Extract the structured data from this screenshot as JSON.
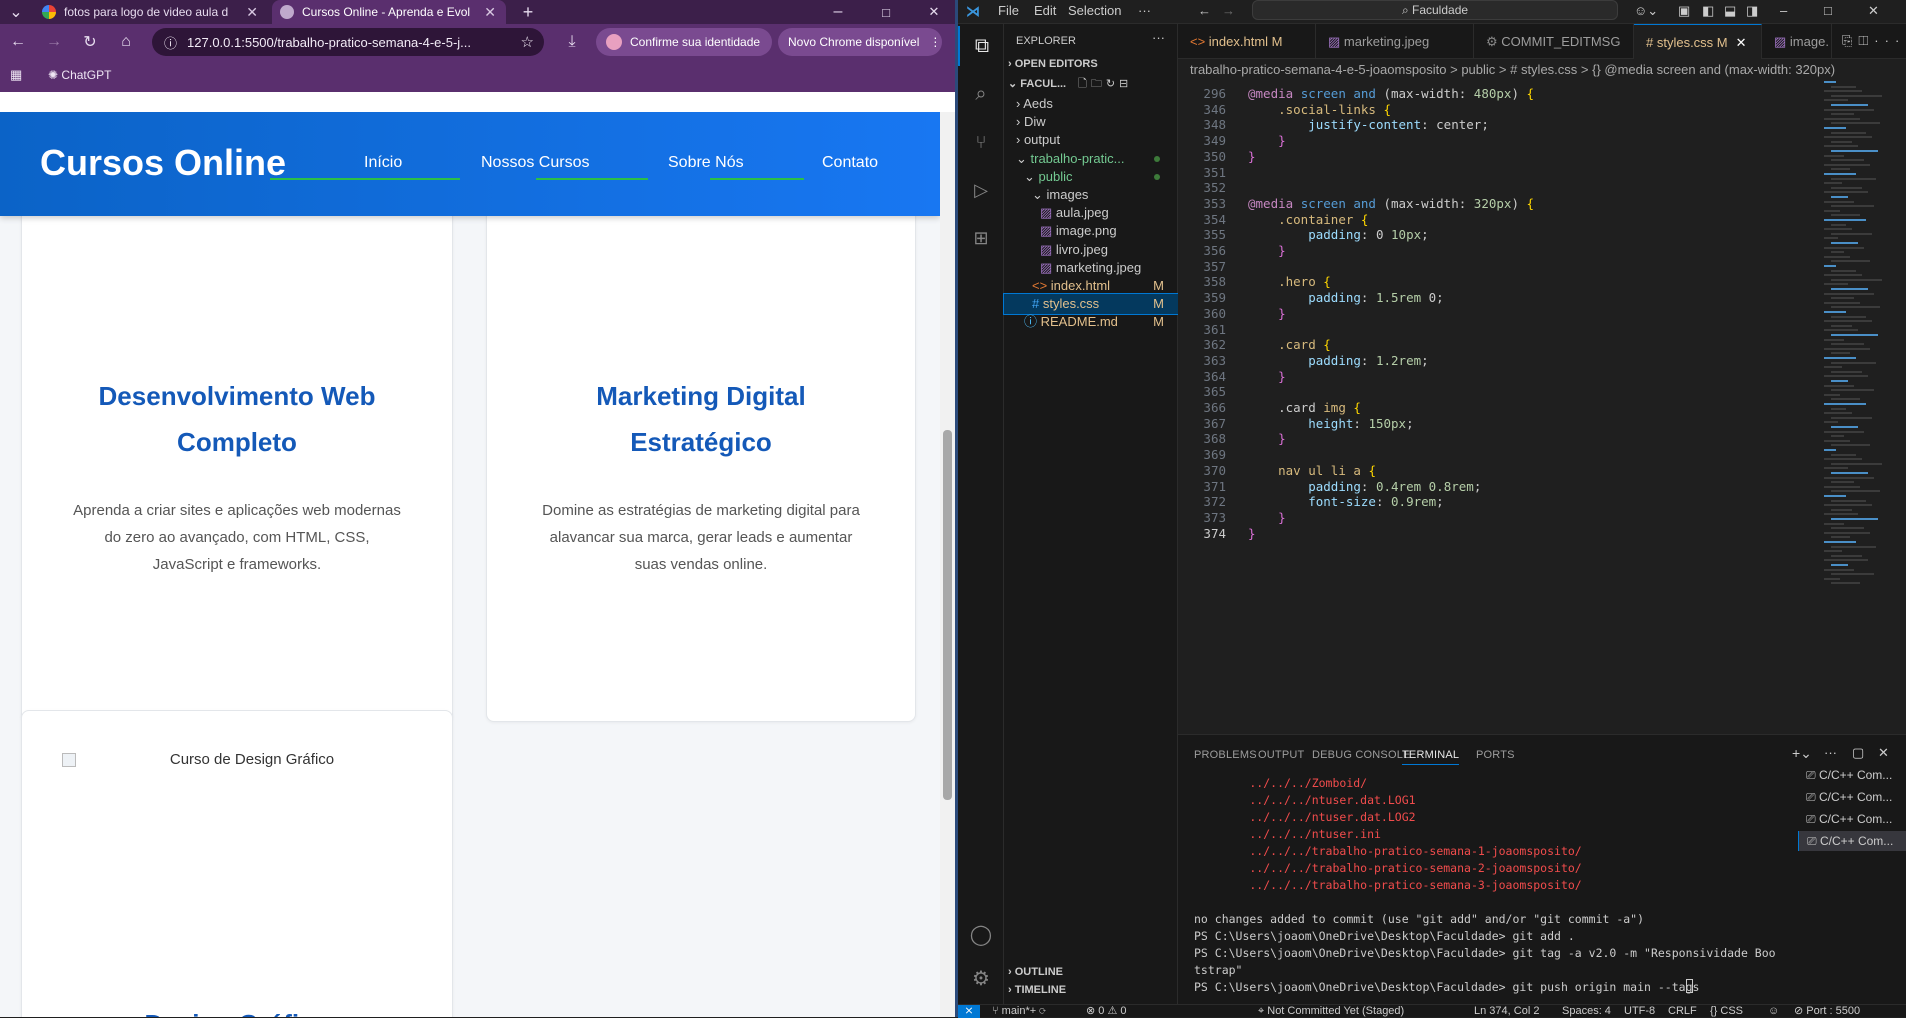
{
  "browser": {
    "tabs": [
      {
        "title": "fotos para logo de video aula d",
        "active": false
      },
      {
        "title": "Cursos Online - Aprenda e Evol",
        "active": true
      }
    ],
    "new_tab": "+",
    "window_controls": [
      "–",
      "□",
      "✕"
    ],
    "url": "127.0.0.1:5500/trabalho-pratico-semana-4-e-5-j...",
    "identity_pill": "Confirme sua identidade",
    "update_pill": "Novo Chrome disponível",
    "bookmark": "ChatGPT"
  },
  "site": {
    "logo": "Cursos Online",
    "nav": [
      "Início",
      "Nossos Cursos",
      "Sobre Nós",
      "Contato"
    ],
    "cards": [
      {
        "title_line1": "Desenvolvimento Web",
        "title_line2": "Completo",
        "desc": [
          "Aprenda a criar sites e aplicações web modernas",
          "do zero ao avançado, com HTML, CSS,",
          "JavaScript e frameworks."
        ]
      },
      {
        "title_line1": "Marketing Digital",
        "title_line2": "Estratégico",
        "desc": [
          "Domine as estratégias de marketing digital para",
          "alavancar sua marca, gerar leads e aumentar",
          "suas vendas online."
        ]
      },
      {
        "img_alt": "Curso de Design Gráfico",
        "title_partial": "Design Gráfico"
      }
    ]
  },
  "vscode": {
    "menu": [
      "File",
      "Edit",
      "Selection",
      "···"
    ],
    "search": "Faculdade",
    "explorer": {
      "header": "EXPLORER",
      "open_editors": "OPEN EDITORS",
      "root": "FACUL...",
      "tree": [
        {
          "label": "Aeds",
          "kind": "folder",
          "depth": 1
        },
        {
          "label": "Diw",
          "kind": "folder",
          "depth": 1
        },
        {
          "label": "output",
          "kind": "folder",
          "depth": 1
        },
        {
          "label": "trabalho-pratic...",
          "kind": "folder-open",
          "depth": 1
        },
        {
          "label": "public",
          "kind": "folder-open",
          "depth": 2
        },
        {
          "label": "images",
          "kind": "folder-open",
          "depth": 3
        },
        {
          "label": "aula.jpeg",
          "kind": "img",
          "depth": 4
        },
        {
          "label": "image.png",
          "kind": "img",
          "depth": 4
        },
        {
          "label": "livro.jpeg",
          "kind": "img",
          "depth": 4
        },
        {
          "label": "marketing.jpeg",
          "kind": "img",
          "depth": 4
        },
        {
          "label": "index.html",
          "kind": "html",
          "depth": 3,
          "badge": "M"
        },
        {
          "label": "styles.css",
          "kind": "css",
          "depth": 3,
          "badge": "M",
          "selected": true
        },
        {
          "label": "README.md",
          "kind": "info",
          "depth": 2,
          "badge": "M"
        }
      ],
      "outline": "OUTLINE",
      "timeline": "TIMELINE"
    },
    "editor_tabs": [
      {
        "label": "index.html M"
      },
      {
        "label": "marketing.jpeg"
      },
      {
        "label": "COMMIT_EDITMSG"
      },
      {
        "label": "# styles.css M",
        "active": true
      },
      {
        "label": "image."
      }
    ],
    "breadcrumb": "trabalho-pratico-semana-4-e-5-joaomsposito  >  public  >  # styles.css  >  {} @media screen and (max-width: 320px)",
    "code": [
      {
        "n": "296",
        "t": "@media screen and (max-width: 480px) {"
      },
      {
        "n": "346",
        "t": "    .social-links {"
      },
      {
        "n": "348",
        "t": "        justify-content: center;"
      },
      {
        "n": "349",
        "t": "    }"
      },
      {
        "n": "350",
        "t": "}"
      },
      {
        "n": "351",
        "t": ""
      },
      {
        "n": "352",
        "t": ""
      },
      {
        "n": "353",
        "t": "@media screen and (max-width: 320px) {"
      },
      {
        "n": "354",
        "t": "    .container {"
      },
      {
        "n": "355",
        "t": "        padding: 0 10px;"
      },
      {
        "n": "356",
        "t": "    }"
      },
      {
        "n": "357",
        "t": ""
      },
      {
        "n": "358",
        "t": "    .hero {"
      },
      {
        "n": "359",
        "t": "        padding: 1.5rem 0;"
      },
      {
        "n": "360",
        "t": "    }"
      },
      {
        "n": "361",
        "t": ""
      },
      {
        "n": "362",
        "t": "    .card {"
      },
      {
        "n": "363",
        "t": "        padding: 1.2rem;"
      },
      {
        "n": "364",
        "t": "    }"
      },
      {
        "n": "365",
        "t": ""
      },
      {
        "n": "366",
        "t": "    .card img {"
      },
      {
        "n": "367",
        "t": "        height: 150px;"
      },
      {
        "n": "368",
        "t": "    }"
      },
      {
        "n": "369",
        "t": ""
      },
      {
        "n": "370",
        "t": "    nav ul li a {"
      },
      {
        "n": "371",
        "t": "        padding: 0.4rem 0.8rem;"
      },
      {
        "n": "372",
        "t": "        font-size: 0.9rem;"
      },
      {
        "n": "373",
        "t": "    }"
      },
      {
        "n": "374",
        "t": "}"
      }
    ],
    "panel_tabs": [
      "PROBLEMS",
      "OUTPUT",
      "DEBUG CONSOLE",
      "TERMINAL",
      "PORTS"
    ],
    "terminal": [
      {
        "t": "        ../../../Zomboid/",
        "red": true
      },
      {
        "t": "        ../../../ntuser.dat.LOG1",
        "red": true
      },
      {
        "t": "        ../../../ntuser.dat.LOG2",
        "red": true
      },
      {
        "t": "        ../../../ntuser.ini",
        "red": true
      },
      {
        "t": "        ../../../trabalho-pratico-semana-1-joaomsposito/",
        "red": true
      },
      {
        "t": "        ../../../trabalho-pratico-semana-2-joaomsposito/",
        "red": true
      },
      {
        "t": "        ../../../trabalho-pratico-semana-3-joaomsposito/",
        "red": true
      },
      {
        "t": "",
        "red": false
      },
      {
        "t": "no changes added to commit (use \"git add\" and/or \"git commit -a\")",
        "red": false
      },
      {
        "t": "PS C:\\Users\\joaom\\OneDrive\\Desktop\\Faculdade> git add .",
        "red": false
      },
      {
        "t": "PS C:\\Users\\joaom\\OneDrive\\Desktop\\Faculdade> git tag -a v2.0 -m \"Responsividade Boo",
        "red": false
      },
      {
        "t": "tstrap\"",
        "red": false
      },
      {
        "t": "PS C:\\Users\\joaom\\OneDrive\\Desktop\\Faculdade> git push origin main --tags",
        "red": false
      }
    ],
    "terminal_list": [
      "C/C++ Com...",
      "C/C++ Com...",
      "C/C++ Com...",
      "C/C++ Com..."
    ],
    "status": {
      "branch": "main*+",
      "problems": "⊗ 0 ⚠ 0",
      "commit": "Not Committed Yet (Staged)",
      "pos": "Ln 374, Col 2",
      "spaces": "Spaces: 4",
      "encoding": "UTF-8",
      "eol": "CRLF",
      "lang": "{} CSS",
      "port": "Port : 5500"
    }
  }
}
